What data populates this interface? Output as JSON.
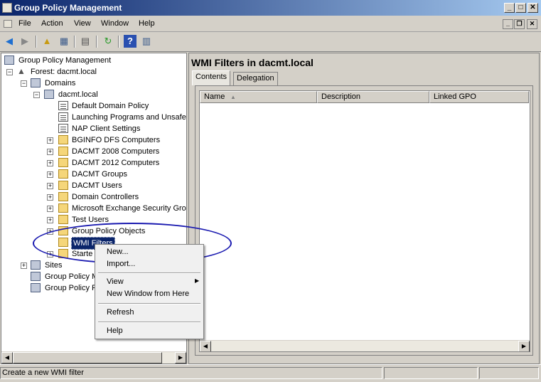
{
  "window": {
    "title": "Group Policy Management"
  },
  "menubar": {
    "items": [
      "File",
      "Action",
      "View",
      "Window",
      "Help"
    ]
  },
  "tree": {
    "root": "Group Policy Management",
    "forest": "Forest: dacmt.local",
    "domains": "Domains",
    "domain": "dacmt.local",
    "gpo_links": [
      "Default Domain Policy",
      "Launching Programs and Unsafe",
      "NAP Client Settings"
    ],
    "ous": [
      "BGINFO DFS Computers",
      "DACMT 2008 Computers",
      "DACMT 2012 Computers",
      "DACMT Groups",
      "DACMT Users",
      "Domain Controllers",
      "Microsoft Exchange Security Grou",
      "Test Users"
    ],
    "gpo_objects": "Group Policy Objects",
    "wmi_filters": "WMI Filters",
    "starter": "Starte",
    "sites": "Sites",
    "modeling": "Group Policy M",
    "results": "Group Policy R"
  },
  "right": {
    "heading": "WMI Filters in dacmt.local",
    "tabs": [
      "Contents",
      "Delegation"
    ],
    "columns": [
      "Name",
      "Description",
      "Linked GPO"
    ]
  },
  "context_menu": {
    "new": "New...",
    "import": "Import...",
    "view": "View",
    "new_window": "New Window from Here",
    "refresh": "Refresh",
    "help": "Help"
  },
  "status": {
    "text": "Create a new WMI filter"
  },
  "colors": {
    "title_start": "#0a246a",
    "title_end": "#a6caf0",
    "highlight": "#1a1ab0"
  }
}
